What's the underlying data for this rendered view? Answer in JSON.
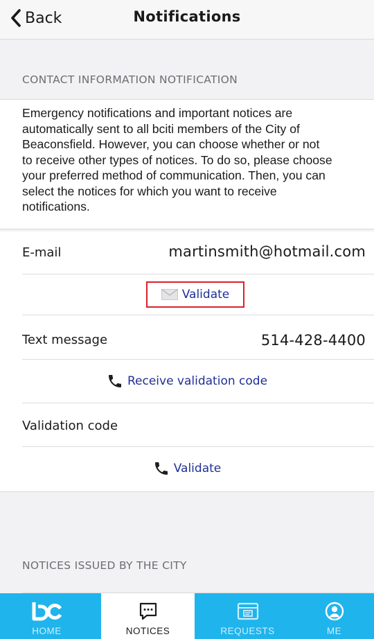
{
  "nav": {
    "back_label": "Back",
    "title": "Notifications"
  },
  "contact_section": {
    "header": "CONTACT INFORMATION NOTIFICATION",
    "description_lines": [
      "Emergency notifications and important notices are",
      "automatically sent to all bciti members of the City of",
      "Beaconsfield. However, you can choose whether or not",
      "to receive other types of notices. To do so, please choose",
      "your preferred method of communication. Then, you can",
      "select the notices for which you want to receive",
      "notifications."
    ]
  },
  "form": {
    "email_label": "E-mail",
    "email_value": "martinsmith@hotmail.com",
    "email_validate_label": "Validate",
    "text_label": "Text message",
    "text_value": "514-428-4400",
    "receive_code_label": "Receive validation code",
    "validation_code_label": "Validation code",
    "validate_code_label": "Validate"
  },
  "notices_section": {
    "header": "NOTICES ISSUED BY THE CITY"
  },
  "tabbar": {
    "active": "NOTICES",
    "tabs": [
      {
        "label": "HOME",
        "icon": "bc-logo-icon"
      },
      {
        "label": "NOTICES",
        "icon": "chat-bubble-icon"
      },
      {
        "label": "REQUESTS",
        "icon": "requests-card-icon"
      },
      {
        "label": "ME",
        "icon": "user-circle-icon"
      }
    ]
  },
  "colors": {
    "link": "#1f2f96",
    "highlight_border": "#d9212a",
    "tabbar": "#1fb4ec"
  }
}
